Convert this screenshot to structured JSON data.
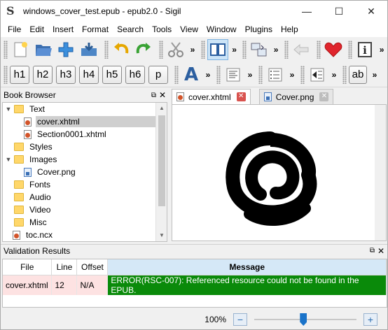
{
  "window": {
    "title": "windows_cover_test.epub - epub2.0 - Sigil",
    "minimize": "—",
    "maximize": "☐",
    "close": "✕"
  },
  "menu": [
    "File",
    "Edit",
    "Insert",
    "Format",
    "Search",
    "Tools",
    "View",
    "Window",
    "Plugins",
    "Help"
  ],
  "toolbar": {
    "overflow": "»",
    "headings": [
      "h1",
      "h2",
      "h3",
      "h4",
      "h5",
      "h6",
      "p"
    ],
    "text_style_letter": "A",
    "ab_label": "ab"
  },
  "book_browser": {
    "title": "Book Browser",
    "items": [
      {
        "type": "folder",
        "label": "Text",
        "expanded": true,
        "depth": 0
      },
      {
        "type": "html",
        "label": "cover.xhtml",
        "depth": 1,
        "selected": true
      },
      {
        "type": "html",
        "label": "Section0001.xhtml",
        "depth": 1
      },
      {
        "type": "folder",
        "label": "Styles",
        "depth": 0
      },
      {
        "type": "folder",
        "label": "Images",
        "expanded": true,
        "depth": 0
      },
      {
        "type": "image",
        "label": "Cover.png",
        "depth": 1
      },
      {
        "type": "folder",
        "label": "Fonts",
        "depth": 0
      },
      {
        "type": "folder",
        "label": "Audio",
        "depth": 0
      },
      {
        "type": "folder",
        "label": "Video",
        "depth": 0
      },
      {
        "type": "folder",
        "label": "Misc",
        "depth": 0
      },
      {
        "type": "file",
        "label": "toc.ncx",
        "depth": 0
      }
    ]
  },
  "tabs": [
    {
      "label": "cover.xhtml",
      "active": true
    },
    {
      "label": "Cover.png",
      "active": false
    }
  ],
  "validation": {
    "title": "Validation Results",
    "columns": [
      "File",
      "Line",
      "Offset",
      "Message"
    ],
    "rows": [
      {
        "file": "cover.xhtml",
        "line": "12",
        "offset": "N/A",
        "message": "ERROR(RSC-007): Referenced resource could not be found in the EPUB."
      }
    ]
  },
  "status": {
    "zoom": "100%",
    "zoom_out": "−",
    "zoom_in": "+",
    "zoom_level_fraction": 0.48
  },
  "colors": {
    "error_bg": "#0a8a0a",
    "selected_tab_close": "#d9534f",
    "header_message_bg": "#d5e8f7"
  }
}
